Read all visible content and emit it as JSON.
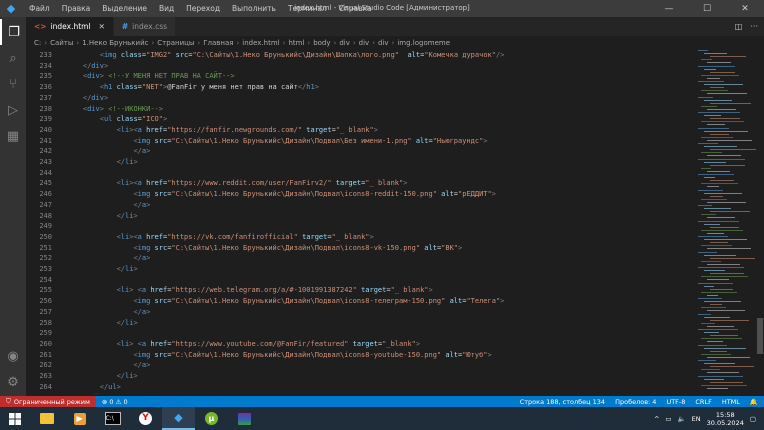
{
  "menu": [
    "Файл",
    "Правка",
    "Выделение",
    "Вид",
    "Переход",
    "Выполнить",
    "Терминал",
    "Справка"
  ],
  "window_title": "index.html - Visual Studio Code [Администратор]",
  "tabs": [
    {
      "label": "index.html",
      "icon": "html-icon"
    },
    {
      "label": "index.css",
      "icon": "css-icon"
    }
  ],
  "breadcrumb": [
    "C:",
    "Сайты",
    "1.Неко Брунькийс",
    "Страницы",
    "Главная",
    "index.html",
    "html",
    "body",
    "div",
    "div",
    "div",
    "img.logomeme"
  ],
  "code_lines": [
    {
      "n": "233",
      "html": "<span class='t-br'>        &lt;</span><span class='t-tag'>img</span> <span class='t-attr'>class</span>=<span class='t-str'>\"IMG2\"</span> <span class='t-attr'>src</span>=<span class='t-str'>\"C:\\Сайты\\1.Неко Брунькийс\\Дизайн\\Шапка\\лого.png\"</span>  <span class='t-attr'>alt</span>=<span class='t-str'>\"Комечка дурачок\"</span><span class='t-br'>/&gt;</span>"
    },
    {
      "n": "234",
      "html": "    <span class='t-br'>&lt;/</span><span class='t-tag'>div</span><span class='t-br'>&gt;</span>"
    },
    {
      "n": "235",
      "html": "    <span class='t-br'>&lt;</span><span class='t-tag'>div</span><span class='t-br'>&gt;</span> <span class='t-cmt'>&lt;!--У МЕНЯ НЕТ ПРАВ НА САЙТ--&gt;</span>"
    },
    {
      "n": "236",
      "html": "        <span class='t-br'>&lt;</span><span class='t-tag'>h1</span> <span class='t-attr'>class</span>=<span class='t-str'>\"NET\"</span><span class='t-br'>&gt;</span><span class='t-txt'>@FanFir у меня нет прав на сайт</span><span class='t-br'>&lt;/</span><span class='t-tag'>h1</span><span class='t-br'>&gt;</span>"
    },
    {
      "n": "237",
      "html": "    <span class='t-br'>&lt;/</span><span class='t-tag'>div</span><span class='t-br'>&gt;</span>"
    },
    {
      "n": "238",
      "html": "    <span class='t-br'>&lt;</span><span class='t-tag'>div</span><span class='t-br'>&gt;</span> <span class='t-cmt'>&lt;!--ИКОНКИ--&gt;</span>"
    },
    {
      "n": "239",
      "html": "        <span class='t-br'>&lt;</span><span class='t-tag'>ul</span> <span class='t-attr'>class</span>=<span class='t-str'>\"ICO\"</span><span class='t-br'>&gt;</span>"
    },
    {
      "n": "240",
      "html": "            <span class='t-br'>&lt;</span><span class='t-tag'>li</span><span class='t-br'>&gt;&lt;</span><span class='t-tag'>a</span> <span class='t-attr'>href</span>=<span class='t-str'>\"https://fanfir.newgrounds.com/\"</span> <span class='t-attr'>target</span>=<span class='t-str'>\"_ blank\"</span><span class='t-br'>&gt;</span>"
    },
    {
      "n": "241",
      "html": "                <span class='t-br'>&lt;</span><span class='t-tag'>img</span> <span class='t-attr'>src</span>=<span class='t-str'>\"C:\\Сайты\\1.Неко Брунькийс\\Дизайн\\Подвал\\Без имени-1.png\"</span> <span class='t-attr'>alt</span>=<span class='t-str'>\"Ньюграундс\"</span><span class='t-br'>&gt;</span>"
    },
    {
      "n": "242",
      "html": "                <span class='t-br'>&lt;/</span><span class='t-tag'>a</span><span class='t-br'>&gt;</span>"
    },
    {
      "n": "243",
      "html": "            <span class='t-br'>&lt;/</span><span class='t-tag'>li</span><span class='t-br'>&gt;</span>"
    },
    {
      "n": "244",
      "html": ""
    },
    {
      "n": "245",
      "html": "            <span class='t-br'>&lt;</span><span class='t-tag'>li</span><span class='t-br'>&gt;&lt;</span><span class='t-tag'>a</span> <span class='t-attr'>href</span>=<span class='t-str'>\"https://www.reddit.com/user/FanFirv2/\"</span> <span class='t-attr'>target</span>=<span class='t-str'>\"_ blank\"</span><span class='t-br'>&gt;</span>"
    },
    {
      "n": "246",
      "html": "                <span class='t-br'>&lt;</span><span class='t-tag'>img</span> <span class='t-attr'>src</span>=<span class='t-str'>\"C:\\Сайты\\1.Неко Брунькийс\\Дизайн\\Подвал\\icons8-reddit-150.png\"</span> <span class='t-attr'>alt</span>=<span class='t-str'>\"рЕДДИТ\"</span><span class='t-br'>&gt;</span>"
    },
    {
      "n": "247",
      "html": "                <span class='t-br'>&lt;/</span><span class='t-tag'>a</span><span class='t-br'>&gt;</span>"
    },
    {
      "n": "248",
      "html": "            <span class='t-br'>&lt;/</span><span class='t-tag'>li</span><span class='t-br'>&gt;</span>"
    },
    {
      "n": "249",
      "html": ""
    },
    {
      "n": "250",
      "html": "            <span class='t-br'>&lt;</span><span class='t-tag'>li</span><span class='t-br'>&gt;&lt;</span><span class='t-tag'>a</span> <span class='t-attr'>href</span>=<span class='t-str'>\"https://vk.com/fanfirofficial\"</span> <span class='t-attr'>target</span>=<span class='t-str'>\"_ blank\"</span><span class='t-br'>&gt;</span>"
    },
    {
      "n": "251",
      "html": "                <span class='t-br'>&lt;</span><span class='t-tag'>img</span> <span class='t-attr'>src</span>=<span class='t-str'>\"C:\\Сайты\\1.Неко Брунькийс\\Дизайн\\Подвал\\icons8-vk-150.png\"</span> <span class='t-attr'>alt</span>=<span class='t-str'>\"ВК\"</span><span class='t-br'>&gt;</span>"
    },
    {
      "n": "252",
      "html": "                <span class='t-br'>&lt;/</span><span class='t-tag'>a</span><span class='t-br'>&gt;</span>"
    },
    {
      "n": "253",
      "html": "            <span class='t-br'>&lt;/</span><span class='t-tag'>li</span><span class='t-br'>&gt;</span>"
    },
    {
      "n": "254",
      "html": ""
    },
    {
      "n": "255",
      "html": "            <span class='t-br'>&lt;</span><span class='t-tag'>li</span><span class='t-br'>&gt;</span> <span class='t-br'>&lt;</span><span class='t-tag'>a</span> <span class='t-attr'>href</span>=<span class='t-str'>\"https://web.telegram.org/a/#-1001991387242\"</span> <span class='t-attr'>target</span>=<span class='t-str'>\"_ blank\"</span><span class='t-br'>&gt;</span>"
    },
    {
      "n": "256",
      "html": "                <span class='t-br'>&lt;</span><span class='t-tag'>img</span> <span class='t-attr'>src</span>=<span class='t-str'>\"C:\\Сайты\\1.Неко Брунькийс\\Дизайн\\Подвал\\icons8-телеграм-150.png\"</span> <span class='t-attr'>alt</span>=<span class='t-str'>\"Телега\"</span><span class='t-br'>&gt;</span>"
    },
    {
      "n": "257",
      "html": "                <span class='t-br'>&lt;/</span><span class='t-tag'>a</span><span class='t-br'>&gt;</span>"
    },
    {
      "n": "258",
      "html": "            <span class='t-br'>&lt;/</span><span class='t-tag'>li</span><span class='t-br'>&gt;</span>"
    },
    {
      "n": "259",
      "html": ""
    },
    {
      "n": "260",
      "html": "            <span class='t-br'>&lt;</span><span class='t-tag'>li</span><span class='t-br'>&gt;</span> <span class='t-br'>&lt;</span><span class='t-tag'>a</span> <span class='t-attr'>href</span>=<span class='t-str'>\"https://www.youtube.com/@FanFir/featured\"</span> <span class='t-attr'>target</span>=<span class='t-str'>\"_blank\"</span><span class='t-br'>&gt;</span>"
    },
    {
      "n": "261",
      "html": "                <span class='t-br'>&lt;</span><span class='t-tag'>img</span> <span class='t-attr'>src</span>=<span class='t-str'>\"C:\\Сайты\\1.Неко Брунькийс\\Дизайн\\Подвал\\icons8-youtube-150.png\"</span> <span class='t-attr'>alt</span>=<span class='t-str'>\"Ютуб\"</span><span class='t-br'>&gt;</span>"
    },
    {
      "n": "262",
      "html": "                <span class='t-br'>&lt;/</span><span class='t-tag'>a</span><span class='t-br'>&gt;</span>"
    },
    {
      "n": "263",
      "html": "            <span class='t-br'>&lt;/</span><span class='t-tag'>li</span><span class='t-br'>&gt;</span>"
    },
    {
      "n": "264",
      "html": "        <span class='t-br'>&lt;/</span><span class='t-tag'>ul</span><span class='t-br'>&gt;</span>"
    },
    {
      "n": "265",
      "html": "    <span class='t-br'>&lt;/</span><span class='t-tag'>div</span><span class='t-br'>&gt;</span>"
    }
  ],
  "status": {
    "left": "Ограниченный режим",
    "position": "Строка 188, столбец 134",
    "spaces": "Пробелов: 4",
    "encoding": "UTF-8",
    "eol": "CRLF",
    "language": "HTML"
  },
  "taskbar": {
    "lang": "EN",
    "time": "15:58",
    "date": "30.05.2024",
    "apps": [
      "explorer-icon",
      "media-player-icon",
      "terminal-icon",
      "yandex-browser-icon",
      "vscode-icon",
      "utorrent-icon",
      "winrar-icon"
    ]
  }
}
